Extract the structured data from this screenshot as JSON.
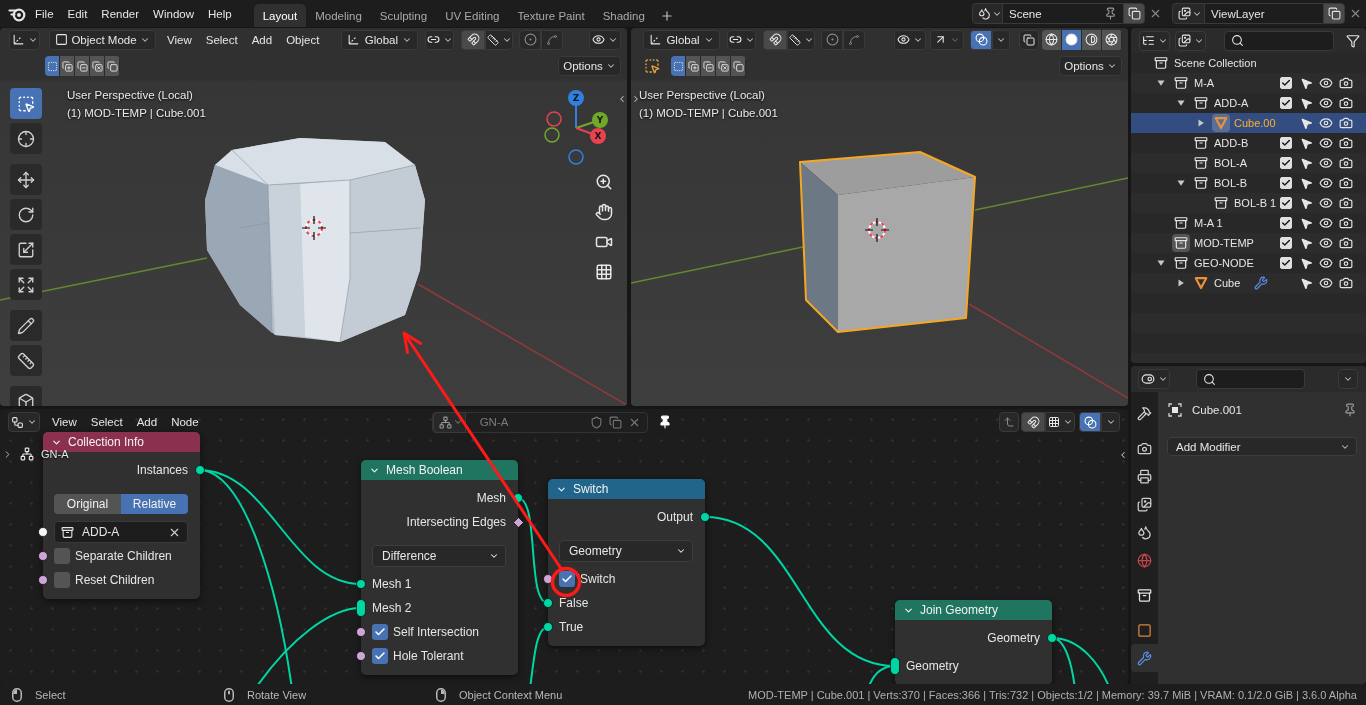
{
  "topbar": {
    "menus": [
      "File",
      "Edit",
      "Render",
      "Window",
      "Help"
    ],
    "workspaces": [
      {
        "label": "Layout",
        "selected": true
      },
      {
        "label": "Modeling",
        "selected": false
      },
      {
        "label": "Sculpting",
        "selected": false
      },
      {
        "label": "UV Editing",
        "selected": false
      },
      {
        "label": "Texture Paint",
        "selected": false
      },
      {
        "label": "Shading",
        "selected": false
      }
    ],
    "scene": "Scene",
    "view_layer": "ViewLayer"
  },
  "viewports": [
    {
      "mode": "Object Mode",
      "menus": [
        "View",
        "Select",
        "Add",
        "Object"
      ],
      "orientation": "Global",
      "options": "Options",
      "select_modes": [
        {
          "selected": true
        },
        {
          "selected": false
        },
        {
          "selected": false
        },
        {
          "selected": false
        },
        {
          "selected": false
        }
      ],
      "tools": [
        {
          "selected": true
        },
        {
          "selected": false
        },
        {
          "selected": false
        },
        {
          "selected": false
        },
        {
          "selected": false
        },
        {
          "selected": false
        },
        {
          "selected": false
        },
        {
          "selected": false
        },
        {
          "selected": false
        }
      ],
      "title": "User Perspective (Local)",
      "info": "(1) MOD-TEMP | Cube.001",
      "gizmo_axes": [
        {
          "label": "Z",
          "color": "#2f80e0"
        },
        {
          "label": "Y",
          "color": "#72a82a"
        },
        {
          "label": "X",
          "color": "#e8414f"
        }
      ],
      "object_selected": false
    },
    {
      "orientation": "Global",
      "options": "Options",
      "select_modes": [
        {
          "selected": true
        },
        {
          "selected": false
        },
        {
          "selected": false
        },
        {
          "selected": false
        },
        {
          "selected": false
        }
      ],
      "overlays": true,
      "shading": [
        {
          "selected": false
        },
        {
          "selected": true
        },
        {
          "selected": false
        },
        {
          "selected": false
        }
      ],
      "title": "User Perspective (Local)",
      "info": "(1) MOD-TEMP | Cube.001",
      "object_selected": true
    }
  ],
  "outliner": {
    "items": [
      {
        "label": "Scene Collection",
        "kind": "scene",
        "selected": false,
        "active": false,
        "children": [
          {
            "label": "M-A",
            "kind": "collection",
            "expanded": true,
            "checked": true,
            "selected": false,
            "active": false,
            "children": [
              {
                "label": "ADD-A",
                "kind": "collection",
                "expanded": true,
                "checked": true,
                "selected": false,
                "active": false,
                "children": [
                  {
                    "label": "Cube.00",
                    "kind": "object",
                    "expanded": false,
                    "selected": true,
                    "active": true,
                    "modifier": false
                  }
                ]
              },
              {
                "label": "ADD-B",
                "kind": "collection",
                "checked": true,
                "selected": false,
                "active": false
              },
              {
                "label": "BOL-A",
                "kind": "collection",
                "checked": true,
                "selected": false,
                "active": false
              },
              {
                "label": "BOL-B",
                "kind": "collection",
                "expanded": true,
                "checked": true,
                "selected": false,
                "active": false,
                "children": [
                  {
                    "label": "BOL-B 1",
                    "kind": "collection",
                    "checked": true,
                    "selected": false,
                    "active": false
                  }
                ]
              }
            ]
          },
          {
            "label": "M-A 1",
            "kind": "collection",
            "checked": true,
            "selected": false,
            "active": false
          },
          {
            "label": "MOD-TEMP",
            "kind": "collection",
            "checked": true,
            "selected": false,
            "active": true
          },
          {
            "label": "GEO-NODE",
            "kind": "collection",
            "expanded": true,
            "checked": true,
            "selected": false,
            "active": false,
            "children": [
              {
                "label": "Cube",
                "kind": "object",
                "expanded": false,
                "selected": false,
                "active": false,
                "modifier": true
              }
            ]
          }
        ]
      }
    ]
  },
  "properties": {
    "tabs": [
      {
        "selected": false
      },
      {
        "selected": false
      },
      {
        "selected": false
      },
      {
        "selected": false
      },
      {
        "selected": false
      },
      {
        "selected": false
      },
      {
        "selected": false
      },
      {
        "selected": false
      },
      {
        "selected": true
      }
    ],
    "object_name": "Cube.001",
    "add_modifier": "Add Modifier"
  },
  "node_editor": {
    "menus": [
      "View",
      "Select",
      "Add",
      "Node"
    ],
    "node_tree": {
      "name": "GN-A",
      "disabled": true
    },
    "pinned": true,
    "overlays": true,
    "breadcrumb": "GN-A",
    "nodes": [
      {
        "title": "Collection Info",
        "color": "#8c3050",
        "rows": [
          {
            "kind": "output",
            "label": "Instances",
            "color": "#00d6a3",
            "field": false,
            "multi_input": false
          },
          {
            "kind": "toggle",
            "options": [
              {
                "label": "Original",
                "selected": false
              },
              {
                "label": "Relative",
                "selected": true
              }
            ]
          },
          {
            "kind": "collection",
            "value": "ADD-A",
            "color": "#f5f5f5",
            "field": false,
            "multi_input": false
          },
          {
            "kind": "checkbox",
            "label": "Separate Children",
            "checked": false,
            "color": "#cca6d6",
            "field": false,
            "multi_input": false
          },
          {
            "kind": "checkbox",
            "label": "Reset Children",
            "checked": false,
            "color": "#cca6d6",
            "field": false,
            "multi_input": false
          }
        ]
      },
      {
        "title": "Mesh Boolean",
        "color": "#1f755f",
        "rows": [
          {
            "kind": "output",
            "label": "Mesh",
            "color": "#00d6a3",
            "field": false,
            "multi_input": false
          },
          {
            "kind": "output",
            "label": "Intersecting Edges",
            "color": "#cca6d6",
            "field": true,
            "multi_input": false
          },
          {
            "kind": "dropdown",
            "value": "Difference"
          },
          {
            "kind": "input",
            "label": "Mesh 1",
            "color": "#00d6a3",
            "field": false,
            "multi_input": false
          },
          {
            "kind": "input",
            "label": "Mesh 2",
            "color": "#00d6a3",
            "field": false,
            "multi_input": true
          },
          {
            "kind": "checkbox",
            "label": "Self Intersection",
            "checked": true,
            "color": "#cca6d6",
            "field": false,
            "multi_input": false
          },
          {
            "kind": "checkbox",
            "label": "Hole Tolerant",
            "checked": true,
            "color": "#cca6d6",
            "field": false,
            "multi_input": false
          }
        ]
      },
      {
        "title": "Switch",
        "color": "#22658a",
        "rows": [
          {
            "kind": "output",
            "label": "Output",
            "color": "#00d6a3",
            "field": false,
            "multi_input": false
          },
          {
            "kind": "dropdown",
            "value": "Geometry"
          },
          {
            "kind": "checkbox",
            "label": "Switch",
            "checked": true,
            "color": "#cca6d6",
            "field": false,
            "multi_input": false
          },
          {
            "kind": "input",
            "label": "False",
            "color": "#00d6a3",
            "field": false,
            "multi_input": false
          },
          {
            "kind": "input",
            "label": "True",
            "color": "#00d6a3",
            "field": false,
            "multi_input": false
          }
        ]
      },
      {
        "title": "Join Geometry",
        "color": "#1f755f",
        "rows": [
          {
            "kind": "output",
            "label": "Geometry",
            "color": "#00d6a3",
            "field": false,
            "multi_input": false
          },
          {
            "kind": "input",
            "label": "Geometry",
            "color": "#00d6a3",
            "field": false,
            "multi_input": true
          }
        ]
      }
    ]
  },
  "status_bar": {
    "hints": [
      "Select",
      "Rotate View",
      "Object Context Menu"
    ],
    "info": "MOD-TEMP | Cube.001 | Verts:370 | Faces:366 | Tris:732 | Objects:1/2 | Memory: 39.7 MiB | VRAM: 0.1/2.0 GiB | 3.6.0 Alpha"
  }
}
